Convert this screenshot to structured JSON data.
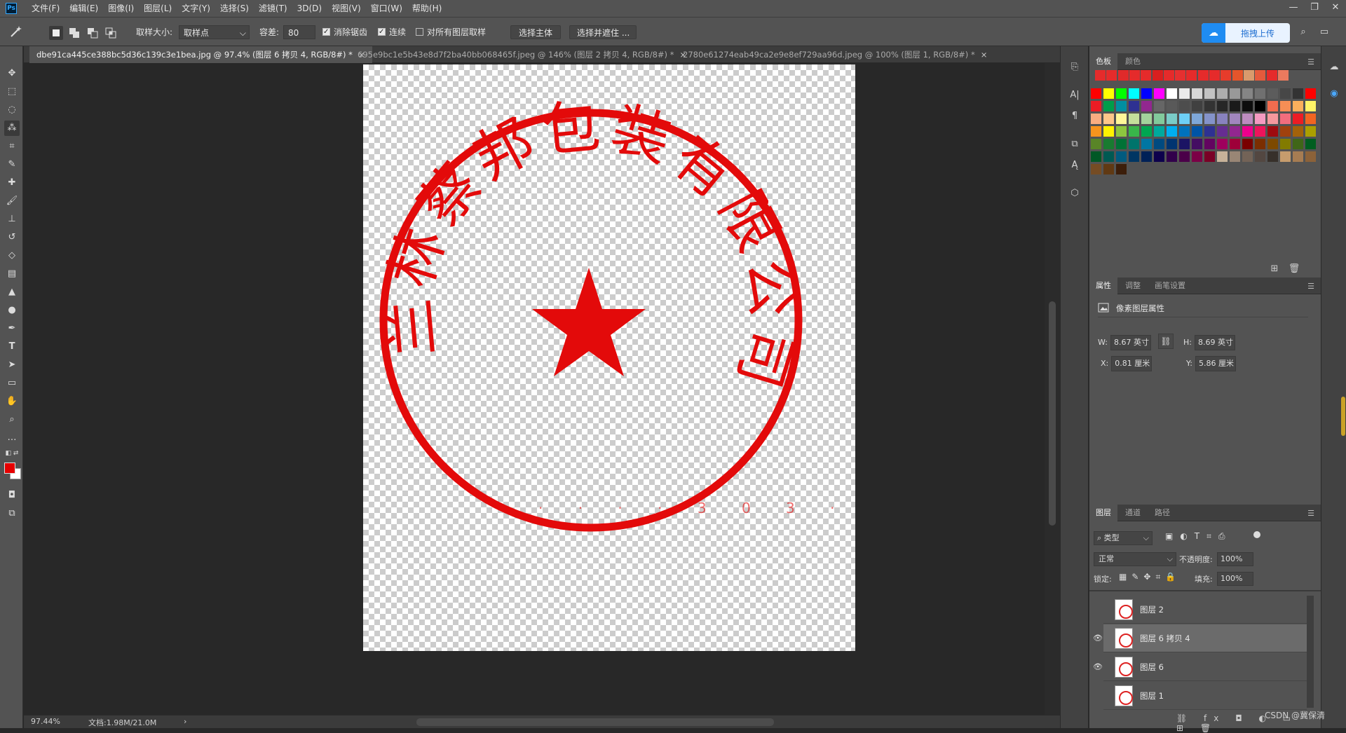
{
  "menubar": {
    "logo": "Ps",
    "items": [
      "文件(F)",
      "编辑(E)",
      "图像(I)",
      "图层(L)",
      "文字(Y)",
      "选择(S)",
      "滤镜(T)",
      "3D(D)",
      "视图(V)",
      "窗口(W)",
      "帮助(H)"
    ],
    "window_controls": [
      "—",
      "❐",
      "✕"
    ]
  },
  "options": {
    "sample_size_label": "取样大小:",
    "sample_size_value": "取样点",
    "tolerance_label": "容差:",
    "tolerance_value": "80",
    "antialias_label": "消除锯齿",
    "contiguous_label": "连续",
    "sample_all_label": "对所有图层取样",
    "select_subject": "选择主体",
    "select_mask": "选择并遮住 ...",
    "share_label": "拖拽上传"
  },
  "tabs": [
    {
      "label": "dbe91ca445ce388bc5d36c139c3e1bea.jpg @ 97.4% (图层 6 拷贝 4, RGB/8#) *",
      "active": true
    },
    {
      "label": "695e9bc1e5b43e8d7f2ba40bb068465f.jpeg @ 146% (图层 2 拷贝 4, RGB/8#) *",
      "active": false
    },
    {
      "label": "2780e61274eab49ca2e9e8ef729aa96d.jpeg @ 100% (图层 1, RGB/8#) *",
      "active": false
    }
  ],
  "document": {
    "seal_text": [
      "兰",
      "林",
      "蔡",
      "邦",
      "包",
      "装",
      "有",
      "限",
      "公",
      "司"
    ]
  },
  "status": {
    "zoom": "97.44%",
    "doc_size": "文档:1.98M/21.0M"
  },
  "swatches_panel": {
    "tabs": [
      "色板",
      "颜色"
    ],
    "colors": {
      "recent": [
        "#e52b2b",
        "#e52b2b",
        "#e02a2a",
        "#e52b2b",
        "#e52b2b",
        "#d91f1f",
        "#e52b2b",
        "#e53030",
        "#e52b2b",
        "#e52b2b",
        "#e52b2b",
        "#e63c2b",
        "#e5552b",
        "#d99a6c",
        "#e55a3c",
        "#e52b2b",
        "#ea7a5e"
      ],
      "rows": [
        [
          "#ff0000",
          "#ffff00",
          "#00ff00",
          "#00ffff",
          "#0000ff",
          "#ff00ff",
          "#ffffff",
          "#ebebeb",
          "#d6d6d6",
          "#c2c2c2",
          "#adadad",
          "#999999",
          "#858585",
          "#707070",
          "#5c5c5c",
          "#474747",
          "#333333",
          "#ff0000"
        ],
        [
          "#ec1c24",
          "#009d4a",
          "#008fa1",
          "#2e3192",
          "#92278f",
          "#666666",
          "#595959",
          "#4d4d4d",
          "#404040",
          "#333333",
          "#262626",
          "#1a1a1a",
          "#0d0d0d",
          "#000000",
          "#f26c4f",
          "#f68e55",
          "#fbaf5c",
          "#fff467"
        ],
        [
          "#f9ad81",
          "#fdc689",
          "#fff799",
          "#c4df9b",
          "#a3d39c",
          "#82ca9c",
          "#7accc8",
          "#6dcff6",
          "#7ea7d8",
          "#8493ca",
          "#8882be",
          "#a186be",
          "#bd8cbf",
          "#f49ac1",
          "#f5989d",
          "#f26d7d",
          "#ed1c24",
          "#f26522"
        ],
        [
          "#f7941d",
          "#fff200",
          "#8dc63f",
          "#39b54a",
          "#00a651",
          "#00a99d",
          "#00aeef",
          "#0072bc",
          "#0054a6",
          "#2e3192",
          "#662d91",
          "#92278f",
          "#ec008c",
          "#ed145b",
          "#9e0b0f",
          "#a0410d",
          "#a3620a",
          "#aba000"
        ],
        [
          "#598527",
          "#197b30",
          "#007236",
          "#00746b",
          "#0076a3",
          "#004a80",
          "#003471",
          "#1b1464",
          "#440e62",
          "#630460",
          "#9e005d",
          "#9e0039",
          "#790000",
          "#7b2e00",
          "#7d4900",
          "#827b00",
          "#406618",
          "#005e20"
        ],
        [
          "#005826",
          "#005952",
          "#005b7f",
          "#003663",
          "#002157",
          "#0d004c",
          "#32004b",
          "#4b0049",
          "#7b0046",
          "#7a0026",
          "#c7b299",
          "#998675",
          "#736357",
          "#534741",
          "#37302a",
          "#c69c6d",
          "#a67c52",
          "#8c6239"
        ],
        [
          "#754c24",
          "#603913",
          "#3c1e0a"
        ]
      ]
    }
  },
  "properties_panel": {
    "tabs": [
      "属性",
      "调整",
      "画笔设置"
    ],
    "header": "像素图层属性",
    "w_label": "W:",
    "w_value": "8.67 英寸",
    "h_label": "H:",
    "h_value": "8.69 英寸",
    "x_label": "X:",
    "x_value": "0.81 厘米",
    "y_label": "Y:",
    "y_value": "5.86 厘米"
  },
  "layers_panel": {
    "tabs": [
      "图层",
      "通道",
      "路径"
    ],
    "filter_label": "类型",
    "blend_mode": "正常",
    "opacity_label": "不透明度:",
    "opacity_value": "100%",
    "lock_label": "锁定:",
    "fill_label": "填充:",
    "fill_value": "100%",
    "layers": [
      {
        "name": "图层 2",
        "visible": false,
        "selected": false
      },
      {
        "name": "图层 6 拷贝 4",
        "visible": true,
        "selected": true
      },
      {
        "name": "图层 6",
        "visible": true,
        "selected": false
      },
      {
        "name": "图层 1",
        "visible": false,
        "selected": false
      }
    ],
    "footer_icons": [
      "link-icon",
      "fx-icon",
      "mask-icon",
      "adjustment-icon",
      "group-icon",
      "new-layer-icon",
      "trash-icon"
    ]
  },
  "watermark": "CSDN @冀保清"
}
